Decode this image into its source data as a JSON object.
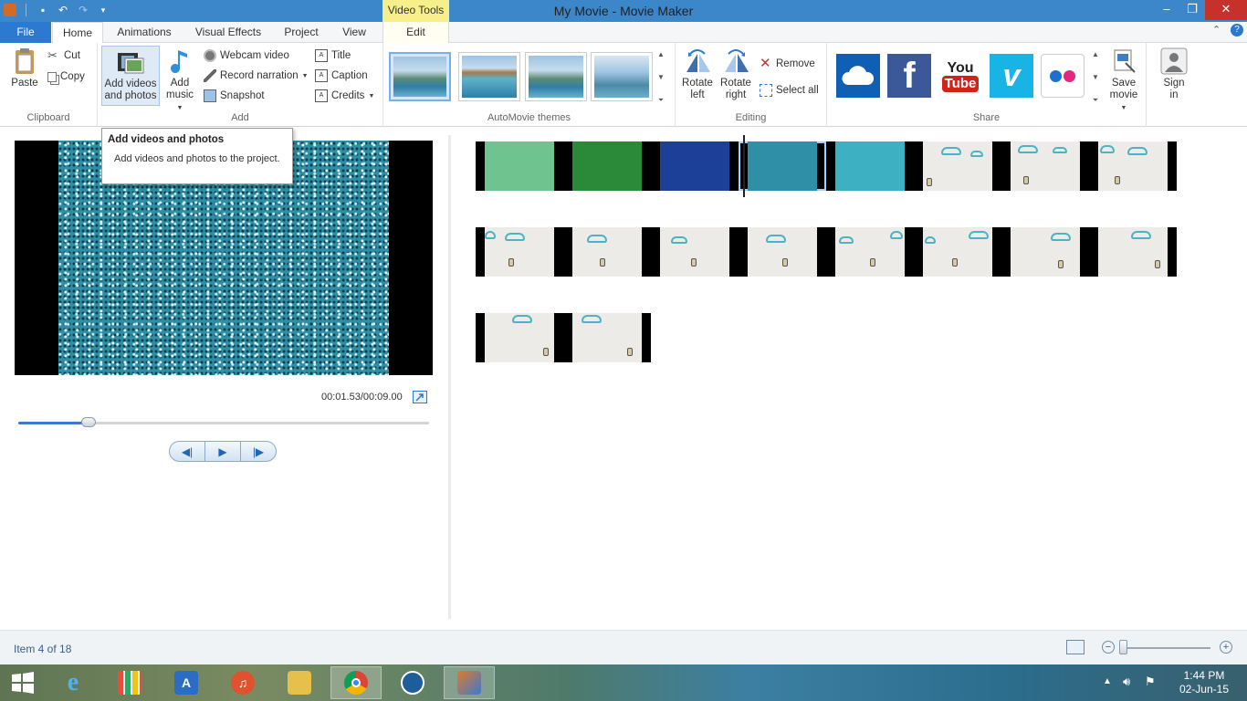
{
  "window": {
    "title": "My Movie - Movie Maker",
    "context_tab_title": "Video Tools"
  },
  "tabs": [
    {
      "label": "File"
    },
    {
      "label": "Home"
    },
    {
      "label": "Animations"
    },
    {
      "label": "Visual Effects"
    },
    {
      "label": "Project"
    },
    {
      "label": "View"
    },
    {
      "label": "Edit"
    }
  ],
  "ribbon": {
    "clipboard": {
      "label": "Clipboard",
      "paste": "Paste",
      "cut": "Cut",
      "copy": "Copy"
    },
    "add": {
      "label": "Add",
      "add_videos_line1": "Add videos",
      "add_videos_line2": "and photos",
      "add_music_line1": "Add",
      "add_music_line2": "music",
      "webcam_video": "Webcam video",
      "record_narration": "Record narration",
      "snapshot": "Snapshot",
      "title": "Title",
      "caption": "Caption",
      "credits": "Credits"
    },
    "themes": {
      "label": "AutoMovie themes"
    },
    "editing": {
      "label": "Editing",
      "rotate_left_line1": "Rotate",
      "rotate_left_line2": "left",
      "rotate_right_line1": "Rotate",
      "rotate_right_line2": "right",
      "remove": "Remove",
      "select_all": "Select all"
    },
    "share": {
      "label": "Share",
      "youtube_line1": "You",
      "youtube_line2": "Tube",
      "save_movie_line1": "Save",
      "save_movie_line2": "movie",
      "sign_in_line1": "Sign",
      "sign_in_line2": "in"
    }
  },
  "tooltip": {
    "title": "Add videos and photos",
    "body": "Add videos and photos to the project."
  },
  "preview": {
    "timecode": "00:01.53/00:09.00",
    "progress": 0.17
  },
  "status": {
    "text": "Item 4 of 18"
  },
  "taskbar": {
    "time": "1:44 PM",
    "date": "02-Jun-15"
  }
}
